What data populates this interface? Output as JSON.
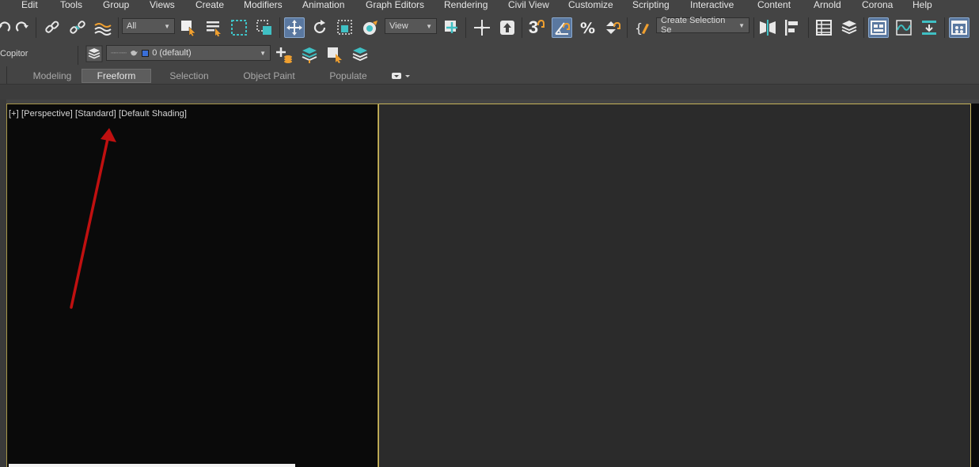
{
  "menu": {
    "items": [
      {
        "label": "Edit"
      },
      {
        "label": "Tools"
      },
      {
        "label": "Group"
      },
      {
        "label": "Views"
      },
      {
        "label": "Create"
      },
      {
        "label": "Modifiers"
      },
      {
        "label": "Animation"
      },
      {
        "label": "Graph Editors"
      },
      {
        "label": "Rendering"
      },
      {
        "label": "Civil View"
      },
      {
        "label": "Customize"
      },
      {
        "label": "Scripting"
      },
      {
        "label": "Interactive"
      },
      {
        "label": "Content"
      },
      {
        "label": "Arnold"
      },
      {
        "label": "Corona"
      },
      {
        "label": "Help"
      }
    ]
  },
  "toolbar": {
    "selection_filter": "All",
    "reference_coord": "View",
    "snap_number": "3",
    "named_selection": "Create Selection Se",
    "icons": [
      "undo-icon",
      "redo-icon",
      "link-icon",
      "unlink-icon",
      "bind-space-warp-icon",
      "select-object-icon",
      "select-by-name-icon",
      "rectangular-region-icon",
      "window-crossing-icon",
      "select-move-icon",
      "select-rotate-icon",
      "select-scale-icon",
      "select-place-icon",
      "use-pivot-icon",
      "select-manipulate-icon",
      "keyboard-shortcut-icon",
      "snaps-toggle-icon",
      "angle-snap-icon",
      "percent-snap-icon",
      "spinner-snap-icon",
      "edit-named-sets-icon",
      "mirror-icon",
      "align-icon",
      "scene-explorer-icon",
      "layer-explorer-icon",
      "toggle-ribbon-icon",
      "curve-editor-icon",
      "schematic-view-icon",
      "material-editor-icon"
    ],
    "active_icons": [
      "select-move-icon",
      "angle-snap-icon",
      "toggle-ribbon-icon",
      "material-editor-icon"
    ]
  },
  "layers_toolbar": {
    "left_label": "Copitor",
    "current_layer": "0 (default)",
    "layer_color": "#3a6fd8"
  },
  "ribbon": {
    "tabs": [
      {
        "label": "Modeling",
        "active": false
      },
      {
        "label": "Freeform",
        "active": true
      },
      {
        "label": "Selection",
        "active": false
      },
      {
        "label": "Object Paint",
        "active": false
      },
      {
        "label": "Populate",
        "active": false
      }
    ]
  },
  "viewport": {
    "label_plus": "[+]",
    "label_view": "[Perspective]",
    "label_style": "[Standard]",
    "label_shading": "[Default Shading]",
    "active_border_color": "#c7b35a"
  },
  "colors": {
    "ui_background": "#444444",
    "accent_active": "#5a78a0",
    "icon_teal": "#3fc0c4",
    "icon_orange": "#f0a030",
    "annotation_arrow": "#c01010"
  }
}
